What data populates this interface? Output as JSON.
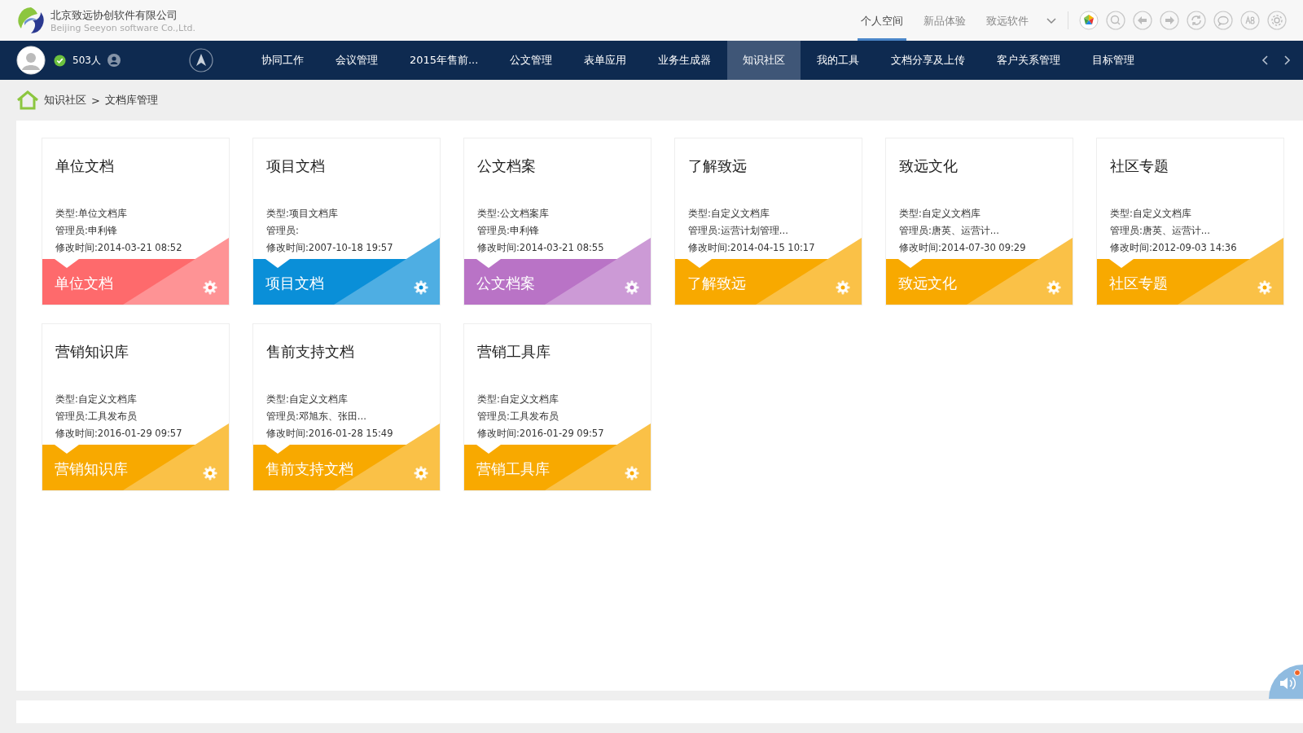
{
  "logo": {
    "name": "北京致远协创软件有限公司",
    "subtitle": "Beijing Seeyon software Co.,Ltd."
  },
  "top_tabs": [
    {
      "label": "个人空间",
      "selected": true
    },
    {
      "label": "新品体验",
      "selected": false
    },
    {
      "label": "致远软件",
      "selected": false
    }
  ],
  "user": {
    "online": true,
    "count": "503人"
  },
  "nav": [
    {
      "label": "协同工作",
      "selected": false
    },
    {
      "label": "会议管理",
      "selected": false
    },
    {
      "label": "2015年售前...",
      "selected": false
    },
    {
      "label": "公文管理",
      "selected": false
    },
    {
      "label": "表单应用",
      "selected": false
    },
    {
      "label": "业务生成器",
      "selected": false
    },
    {
      "label": "知识社区",
      "selected": true
    },
    {
      "label": "我的工具",
      "selected": false
    },
    {
      "label": "文档分享及上传",
      "selected": false
    },
    {
      "label": "客户关系管理",
      "selected": false
    },
    {
      "label": "目标管理",
      "selected": false
    }
  ],
  "breadcrumb": [
    "知识社区",
    ">",
    "文档库管理"
  ],
  "libraries": [
    {
      "title": "单位文档",
      "type": "类型:单位文档库",
      "admin": "管理员:申利锋",
      "modified": "修改时间:2014-03-21 08:52",
      "banner": "单位文档",
      "color": "#fe6a6c"
    },
    {
      "title": "项目文档",
      "type": "类型:项目文档库",
      "admin": "管理员:",
      "modified": "修改时间:2007-10-18 19:57",
      "banner": "项目文档",
      "color": "#0a8fd8"
    },
    {
      "title": "公文档案",
      "type": "类型:公文档案库",
      "admin": "管理员:申利锋",
      "modified": "修改时间:2014-03-21 08:55",
      "banner": "公文档案",
      "color": "#b973c6"
    },
    {
      "title": "了解致远",
      "type": "类型:自定义文档库",
      "admin": "管理员:运营计划管理...",
      "modified": "修改时间:2014-04-15 10:17",
      "banner": "了解致远",
      "color": "#f8a900"
    },
    {
      "title": "致远文化",
      "type": "类型:自定义文档库",
      "admin": "管理员:唐英、运营计...",
      "modified": "修改时间:2014-07-30 09:29",
      "banner": "致远文化",
      "color": "#f8a900"
    },
    {
      "title": "社区专题",
      "type": "类型:自定义文档库",
      "admin": "管理员:唐英、运营计...",
      "modified": "修改时间:2012-09-03 14:36",
      "banner": "社区专题",
      "color": "#f8a900"
    },
    {
      "title": "营销知识库",
      "type": "类型:自定义文档库",
      "admin": "管理员:工具发布员",
      "modified": "修改时间:2016-01-29 09:57",
      "banner": "营销知识库",
      "color": "#f8a900"
    },
    {
      "title": "售前支持文档",
      "type": "类型:自定义文档库",
      "admin": "管理员:邓旭东、张田...",
      "modified": "修改时间:2016-01-28 15:49",
      "banner": "售前支持文档",
      "color": "#f8a900"
    },
    {
      "title": "营销工具库",
      "type": "类型:自定义文档库",
      "admin": "管理员:工具发布员",
      "modified": "修改时间:2016-01-29 09:57",
      "banner": "营销工具库",
      "color": "#f8a900"
    }
  ]
}
